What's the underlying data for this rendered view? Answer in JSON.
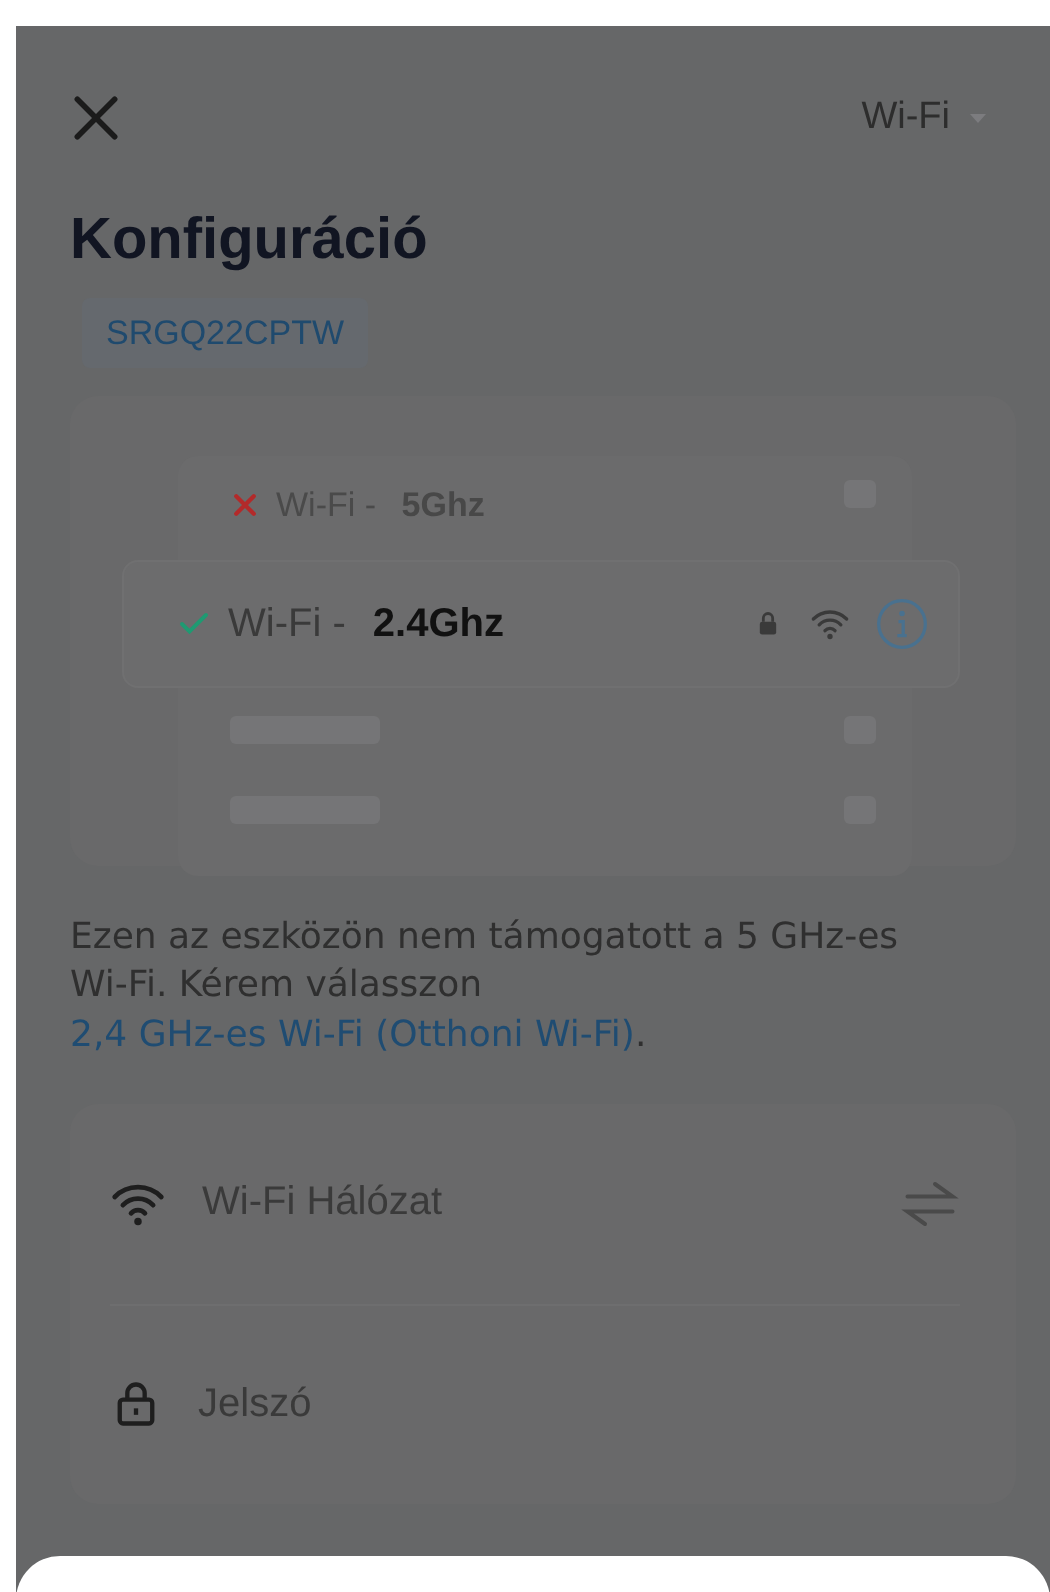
{
  "header": {
    "network_type": "Wi-Fi"
  },
  "title": "Konfiguráció",
  "device_id": "SRGQ22CPTW",
  "networks": [
    {
      "name": "Wi-Fi - ",
      "band": "5Ghz",
      "supported": false,
      "selected": false
    },
    {
      "name": "Wi-Fi - ",
      "band": "2.4Ghz",
      "supported": true,
      "selected": true
    }
  ],
  "note": {
    "text": "Ezen az eszközön nem támogatott a 5 GHz-es Wi-Fi. Kérem válasszon ",
    "link": "2,4 GHz-es Wi-Fi (Otthoni Wi-Fi)",
    "end": "."
  },
  "fields": [
    {
      "kind": "network",
      "placeholder": "Wi-Fi Hálózat"
    },
    {
      "kind": "password",
      "placeholder": "Jelszó"
    }
  ]
}
